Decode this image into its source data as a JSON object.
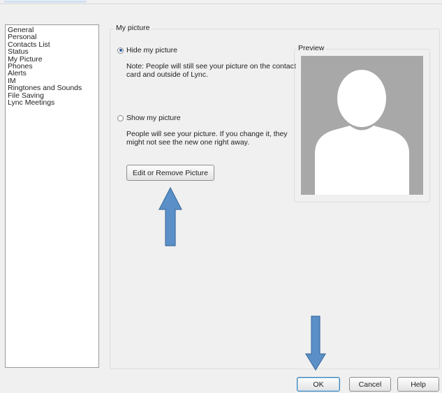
{
  "nav": {
    "items": [
      {
        "label": "General"
      },
      {
        "label": "Personal"
      },
      {
        "label": "Contacts List"
      },
      {
        "label": "Status"
      },
      {
        "label": "My Picture"
      },
      {
        "label": "Phones"
      },
      {
        "label": "Alerts"
      },
      {
        "label": "IM"
      },
      {
        "label": "Ringtones and Sounds"
      },
      {
        "label": "File Saving"
      },
      {
        "label": "Lync Meetings"
      }
    ]
  },
  "picture": {
    "group_title": "My picture",
    "hide_option": {
      "label": "Hide my picture",
      "selected": true
    },
    "hide_note": {
      "line1": "Note: People will still see your picture on the contact",
      "line2": "card and outside of Lync."
    },
    "show_option": {
      "label": "Show my picture",
      "selected": false
    },
    "show_note": {
      "line1": "People will see your picture. If you change it, they",
      "line2": "might not see the new one right away."
    },
    "edit_button": "Edit or Remove Picture"
  },
  "preview": {
    "title": "Preview",
    "icon": "default-person-silhouette"
  },
  "footer": {
    "ok": "OK",
    "cancel": "Cancel",
    "help": "Help"
  },
  "colors": {
    "annotation_arrow": "#5b8fc7",
    "avatar_background": "#a8a8a8"
  }
}
